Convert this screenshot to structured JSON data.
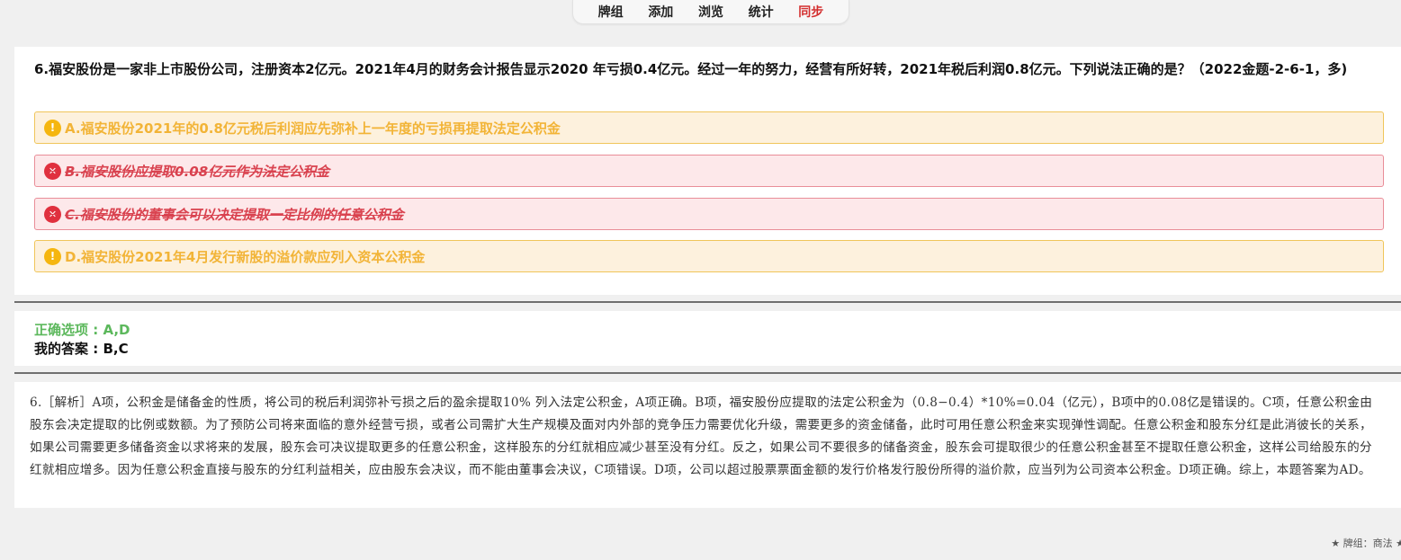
{
  "nav": {
    "items": [
      "牌组",
      "添加",
      "浏览",
      "统计"
    ],
    "sync_label": "同步"
  },
  "question": {
    "text": "6.福安股份是一家非上市股份公司，注册资本2亿元。2021年4月的财务会计报告显示2020 年亏损0.4亿元。经过一年的努力，经营有所好转，2021年税后利润0.8亿元。下列说法正确的是？（2022金题-2-6-1，多)",
    "options": [
      {
        "label": "A.福安股份2021年的0.8亿元税后利润应先弥补上一年度的亏损再提取法定公积金",
        "state": "missed",
        "icon": "exclamation-icon"
      },
      {
        "label": "B.福安股份应提取0.08亿元作为法定公积金",
        "state": "wrong",
        "icon": "x-icon"
      },
      {
        "label": "C.福安股份的董事会可以决定提取一定比例的任意公积金",
        "state": "wrong",
        "icon": "x-icon"
      },
      {
        "label": "D.福安股份2021年4月发行新股的溢价款应列入资本公积金",
        "state": "missed",
        "icon": "exclamation-icon"
      }
    ]
  },
  "answer": {
    "correct_label": "正确选项",
    "correct_value": "A,D",
    "mine_label": "我的答案",
    "mine_value": "B,C"
  },
  "explanation": {
    "prefix": "6.［解析］",
    "text": "A项，公积金是储备金的性质，将公司的税后利润弥补亏损之后的盈余提取10% 列入法定公积金，A项正确。B项，福安股份应提取的法定公积金为（0.8−0.4）*10%=0.04（亿元），B项中的0.08亿是错误的。C项，任意公积金由股东会决定提取的比例或数额。为了预防公司将来面临的意外经营亏损，或者公司需扩大生产规模及面对内外部的竞争压力需要优化升级，需要更多的资金储备，此时可用任意公积金来实现弹性调配。任意公积金和股东分红是此消彼长的关系，如果公司需要更多储备资金以求将来的发展，股东会可决议提取更多的任意公积金，这样股东的分红就相应减少甚至没有分红。反之，如果公司不要很多的储备资金，股东会可提取很少的任意公积金甚至不提取任意公积金，这样公司给股东的分红就相应增多。因为任意公积金直接与股东的分红利益相关，应由股东会决议，而不能由董事会决议，C项错误。D项，公司以超过股票票面金额的发行价格发行股份所得的溢价款，应当列为公司资本公积金。D项正确。综上，本题答案为AD。"
  },
  "footer": {
    "text": "★ 牌组：商法 ★"
  },
  "colors": {
    "warn_text": "#f2b437",
    "wrong_text": "#d9424f",
    "correct_green": "#5cb85c",
    "sync_red": "#d32f2f"
  }
}
